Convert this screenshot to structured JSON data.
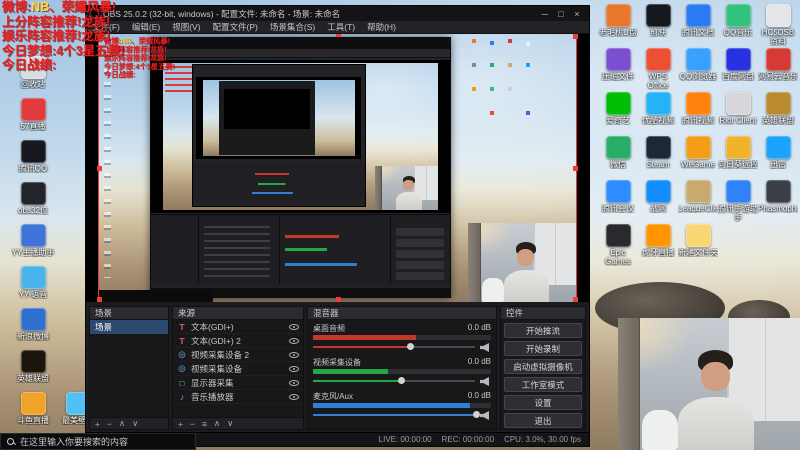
{
  "overlay": {
    "l1a": "微博:",
    "l1b": "NB",
    "l1c": "、荣耀风暴!",
    "l2": "上分阵容推荐!龙族!",
    "l3": "娱乐阵容推荐!龙族!",
    "l4": "今日梦想:4个3星五费!",
    "l5": "今日战绩:"
  },
  "desktop": {
    "left_icons": [
      {
        "label": "回收站",
        "color": "#d8dde2"
      },
      {
        "label": "57直播",
        "color": "#e23b3b"
      },
      {
        "label": "腾讯QQ",
        "color": "#15181e"
      },
      {
        "label": "obs32位",
        "color": "#23242a"
      },
      {
        "label": "YY主播助手",
        "color": "#3f74d8"
      },
      {
        "label": "YY-语音",
        "color": "#49b4ec"
      },
      {
        "label": "新浪微博",
        "color": "#2e6fd0"
      },
      {
        "label": "英雄联盟",
        "color": "#1a150d"
      },
      {
        "label": "斗鱼直播",
        "color": "#f0a32b"
      }
    ],
    "left_icons_col2": [
      {
        "label": "最美壁纸",
        "color": "#52c1f1"
      }
    ],
    "right_icons": [
      {
        "label": "老毛桃U盘",
        "color": "#e8762c"
      },
      {
        "label": "剪映",
        "color": "#15181d"
      },
      {
        "label": "腾讯文档",
        "color": "#2b7bf3"
      },
      {
        "label": "QQ音乐",
        "color": "#31c27c"
      },
      {
        "label": "HC5DSB资料",
        "color": "#e3e5e8"
      },
      {
        "label": "压缩文件",
        "color": "#7a4fd0"
      },
      {
        "label": "WPS Office",
        "color": "#eb5034"
      },
      {
        "label": "QQ浏览器",
        "color": "#3aa0ff"
      },
      {
        "label": "百度网盘",
        "color": "#2932e1"
      },
      {
        "label": "网易云音乐",
        "color": "#d43c33"
      },
      {
        "label": "爱奇艺",
        "color": "#00be06"
      },
      {
        "label": "优酷视频",
        "color": "#24b3f8"
      },
      {
        "label": "腾讯视频",
        "color": "#ff820f"
      },
      {
        "label": "Riot Client",
        "color": "#d7d7db"
      },
      {
        "label": "英雄联盟",
        "color": "#b98a2f"
      },
      {
        "label": "微信",
        "color": "#2aae67"
      },
      {
        "label": "Steam",
        "color": "#1b2838"
      },
      {
        "label": "WeGame",
        "color": "#f49e18"
      },
      {
        "label": "向日葵远控",
        "color": "#f0b32c"
      },
      {
        "label": "迅雷",
        "color": "#1aa3ff"
      },
      {
        "label": "腾讯会议",
        "color": "#2d8cff"
      },
      {
        "label": "战网",
        "color": "#148eff"
      },
      {
        "label": "LeagueClient",
        "color": "#c8aa6e"
      },
      {
        "label": "腾讯手游助手",
        "color": "#2f83f7"
      },
      {
        "label": "Phasmophobia",
        "color": "#3b3f46"
      },
      {
        "label": "Epic Games",
        "color": "#2a2a2e"
      },
      {
        "label": "虎牙直播",
        "color": "#ff9600"
      },
      {
        "label": "新建文件夹",
        "color": "#f7d674"
      }
    ]
  },
  "obs": {
    "title": "OBS 25.0.2 (32-bit, windows) - 配置文件: 未命名 - 场景: 未命名",
    "window_buttons": {
      "min": "─",
      "max": "□",
      "close": "×"
    },
    "menu": [
      "文件(F)",
      "编辑(E)",
      "视图(V)",
      "配置文件(P)",
      "场景集合(S)",
      "工具(T)",
      "帮助(H)"
    ],
    "scenes": {
      "title": "场景",
      "items": [
        "场景"
      ],
      "toolbar": [
        "+",
        "−",
        "∧",
        "∨"
      ]
    },
    "sources": {
      "title": "来源",
      "items": [
        {
          "icon": "T",
          "icolor": "#e06060",
          "name": "文本(GDI+)"
        },
        {
          "icon": "T",
          "icolor": "#e06060",
          "name": "文本(GDI+) 2"
        },
        {
          "icon": "◎",
          "icolor": "#6fb3e0",
          "name": "视频采集设备 2"
        },
        {
          "icon": "◎",
          "icolor": "#6fb3e0",
          "name": "视频采集设备"
        },
        {
          "icon": "□",
          "icolor": "#7ac98a",
          "name": "显示器采集"
        },
        {
          "icon": "♪",
          "icolor": "#b48ad6",
          "name": "音乐播放器"
        }
      ],
      "toolbar": [
        "+",
        "−",
        "≡",
        "∧",
        "∨"
      ]
    },
    "mixer": {
      "title": "混音器",
      "channels": [
        {
          "name": "桌面音频",
          "db": "0.0 dB",
          "color": "#c0392b",
          "level": "58%",
          "slider": "55%"
        },
        {
          "name": "视频采集设备",
          "db": "0.0 dB",
          "color": "#27a644",
          "level": "42%",
          "slider": "50%"
        },
        {
          "name": "麦克风/Aux",
          "db": "0.0 dB",
          "color": "#2f7fd6",
          "level": "88%",
          "slider": "92%"
        }
      ]
    },
    "controls": {
      "title": "控件",
      "buttons": [
        "开始推流",
        "开始录制",
        "启动虚拟摄像机",
        "工作室模式",
        "设置",
        "退出"
      ]
    },
    "status": {
      "live": "LIVE: 00:00:00",
      "rec": "REC: 00:00:00",
      "cpu": "CPU: 3.0%, 30.00 fps"
    }
  },
  "taskbar": {
    "search_placeholder": "在这里输入你要搜索的内容"
  }
}
